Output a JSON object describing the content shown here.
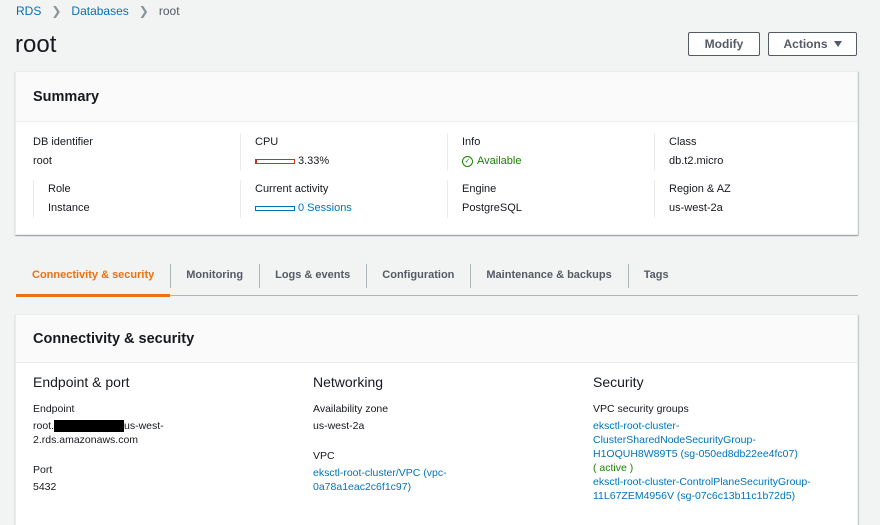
{
  "breadcrumb": {
    "rds": "RDS",
    "databases": "Databases",
    "current": "root"
  },
  "title": "root",
  "buttons": {
    "modify": "Modify",
    "actions": "Actions"
  },
  "summary": {
    "header": "Summary",
    "db_identifier_label": "DB identifier",
    "db_identifier_value": "root",
    "cpu_label": "CPU",
    "cpu_value": "3.33%",
    "cpu_fraction": 0.0333,
    "info_label": "Info",
    "info_value": "Available",
    "class_label": "Class",
    "class_value": "db.t2.micro",
    "role_label": "Role",
    "role_value": "Instance",
    "activity_label": "Current activity",
    "activity_value": "0 Sessions",
    "engine_label": "Engine",
    "engine_value": "PostgreSQL",
    "region_label": "Region & AZ",
    "region_value": "us-west-2a"
  },
  "tabs": [
    "Connectivity & security",
    "Monitoring",
    "Logs & events",
    "Configuration",
    "Maintenance & backups",
    "Tags"
  ],
  "connectivity": {
    "header": "Connectivity & security",
    "endpoint_section": "Endpoint & port",
    "endpoint_label": "Endpoint",
    "endpoint_prefix": "root.",
    "endpoint_suffix": "us-west-",
    "endpoint_line2": "2.rds.amazonaws.com",
    "port_label": "Port",
    "port_value": "5432",
    "networking_section": "Networking",
    "az_label": "Availability zone",
    "az_value": "us-west-2a",
    "vpc_label": "VPC",
    "vpc_value_1": "eksctl-root-cluster/VPC (vpc-",
    "vpc_value_2": "0a78a1eac2c6f1c97)",
    "security_section": "Security",
    "sg_label": "VPC security groups",
    "sg1_line1": "eksctl-root-cluster-",
    "sg1_line2": "ClusterSharedNodeSecurityGroup-",
    "sg1_line3": "H1OQUH8W89T5 (sg-050ed8db22ee4fc07)",
    "sg1_status": "( active )",
    "sg2_line1": "eksctl-root-cluster-ControlPlaneSecurityGroup-",
    "sg2_line2": "11L67ZEM4956V (sg-07c6c13b11c1b72d5)"
  },
  "colors": {
    "link": "#0073bb",
    "active_tab": "#ec7211",
    "ok": "#1d8102",
    "cpu_bar": "#d13212"
  }
}
